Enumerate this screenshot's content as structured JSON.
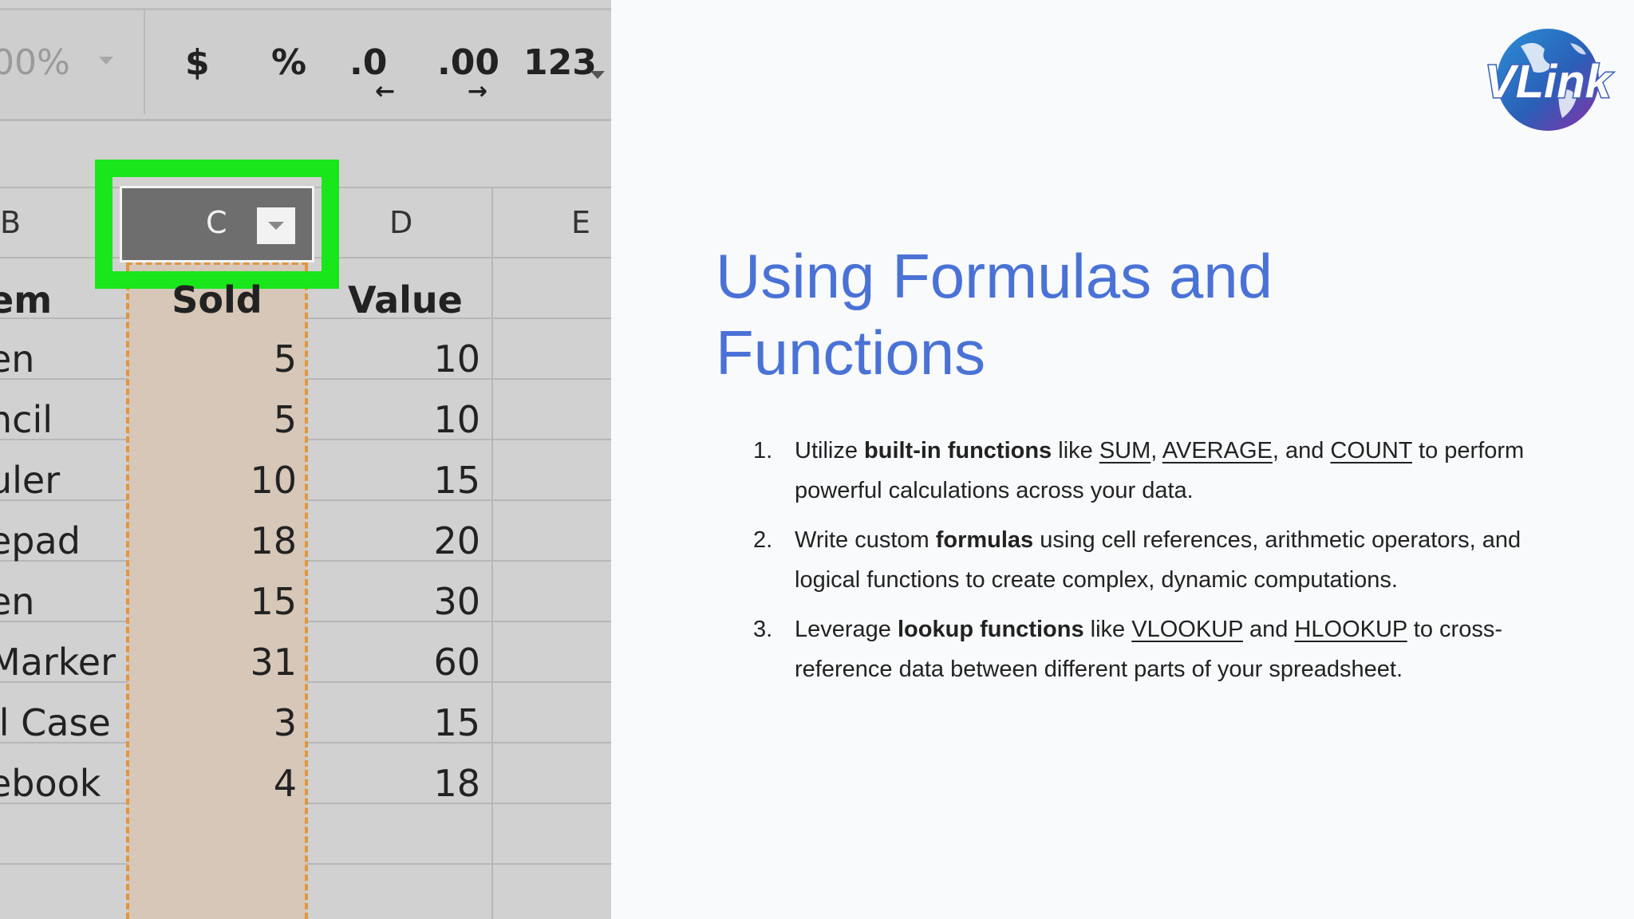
{
  "sheet": {
    "toolbar": {
      "zoom": "00%",
      "currency": "$",
      "percent": "%",
      "decrease_decimal": ".0",
      "increase_decimal": ".00",
      "more_formats": "123"
    },
    "columns": {
      "b": "B",
      "c": "C",
      "d": "D",
      "e": "E"
    },
    "headers": {
      "item": "em",
      "sold": "Sold",
      "value": "Value"
    },
    "rows": [
      {
        "item": "en",
        "sold": "5",
        "value": "10"
      },
      {
        "item": "ncil",
        "sold": "5",
        "value": "10"
      },
      {
        "item": "uler",
        "sold": "10",
        "value": "15"
      },
      {
        "item": "epad",
        "sold": "18",
        "value": "20"
      },
      {
        "item": "en",
        "sold": "15",
        "value": "30"
      },
      {
        "item": "Marker",
        "sold": "31",
        "value": "60"
      },
      {
        "item": "il Case",
        "sold": "3",
        "value": "15"
      },
      {
        "item": "ebook",
        "sold": "4",
        "value": "18"
      }
    ],
    "colors": {
      "selection_frame": "#19e61b",
      "selection_dash": "#e19640",
      "selected_fill": "#d6c7b8"
    }
  },
  "logo": {
    "text": "VLink"
  },
  "slide": {
    "title": "Using Formulas and Functions",
    "title_color": "#4a72d6",
    "items": [
      {
        "num": "1.",
        "t1": "Utilize ",
        "b1": "built-in functions",
        "t2": " like ",
        "l1": "SUM",
        "t3": ", ",
        "l2": "AVERAGE",
        "t4": ", and ",
        "l3": "COUNT",
        "t5": " to perform powerful calculations across your data."
      },
      {
        "num": "2.",
        "t1": "Write custom ",
        "b1": "formulas",
        "t2": " using cell references, arithmetic operators, and logical functions to create complex, dynamic computations."
      },
      {
        "num": "3.",
        "t1": "Leverage ",
        "b1": "lookup functions",
        "t2": " like ",
        "l1": "VLOOKUP",
        "t3": " and ",
        "l2": "HLOOKUP",
        "t4": " to cross-reference data between different parts of your spreadsheet."
      }
    ]
  }
}
